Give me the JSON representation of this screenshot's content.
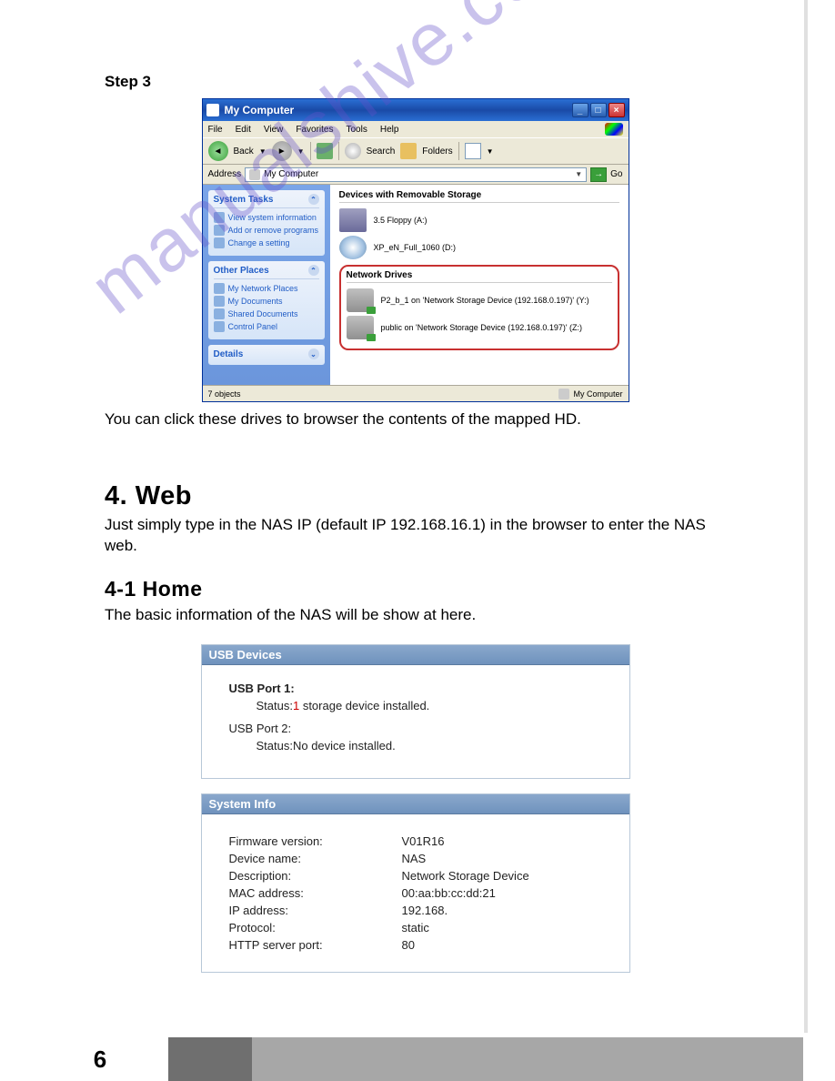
{
  "step_label": "Step 3",
  "xp": {
    "title": "My Computer",
    "menus": [
      "File",
      "Edit",
      "View",
      "Favorites",
      "Tools",
      "Help"
    ],
    "toolbar": {
      "back": "Back",
      "search": "Search",
      "folders": "Folders"
    },
    "address_label": "Address",
    "address_value": "My Computer",
    "go": "Go",
    "side": {
      "tasks_title": "System Tasks",
      "tasks": [
        "View system information",
        "Add or remove programs",
        "Change a setting"
      ],
      "places_title": "Other Places",
      "places": [
        "My Network Places",
        "My Documents",
        "Shared Documents",
        "Control Panel"
      ],
      "details_title": "Details"
    },
    "main": {
      "removable_header": "Devices with Removable Storage",
      "floppy": "3.5 Floppy (A:)",
      "cd": "XP_eN_Full_1060 (D:)",
      "network_header": "Network Drives",
      "drive1": "P2_b_1 on 'Network Storage Device (192.168.0.197)' (Y:)",
      "drive2": "public on 'Network Storage Device (192.168.0.197)' (Z:)"
    },
    "status_left": "7 objects",
    "status_right": "My Computer"
  },
  "caption": "You can click these drives to browser the contents of the mapped HD.",
  "h_web": "4. Web",
  "web_text": "Just simply type in the NAS IP (default IP 192.168.16.1) in the browser to enter the NAS web.",
  "h_home": "4-1 Home",
  "home_text": "The basic information of the NAS will be show at here.",
  "usb": {
    "title": "USB Devices",
    "port1": "USB Port 1:",
    "port1_status_pre": "Status:",
    "port1_count": "1",
    "port1_status_post": " storage device installed.",
    "port2": "USB Port 2:",
    "port2_status": "Status:No device installed."
  },
  "sys": {
    "title": "System Info",
    "rows": [
      {
        "label": "Firmware version:",
        "value": "V01R16"
      },
      {
        "label": "Device name:",
        "value": "NAS"
      },
      {
        "label": "Description:",
        "value": "Network Storage Device"
      },
      {
        "label": "MAC address:",
        "value": "00:aa:bb:cc:dd:21"
      },
      {
        "label": "IP address:",
        "value": "192.168."
      },
      {
        "label": "Protocol:",
        "value": "static"
      },
      {
        "label": "HTTP server port:",
        "value": "80"
      }
    ]
  },
  "watermark": "manualshive.com",
  "page_number": "6"
}
